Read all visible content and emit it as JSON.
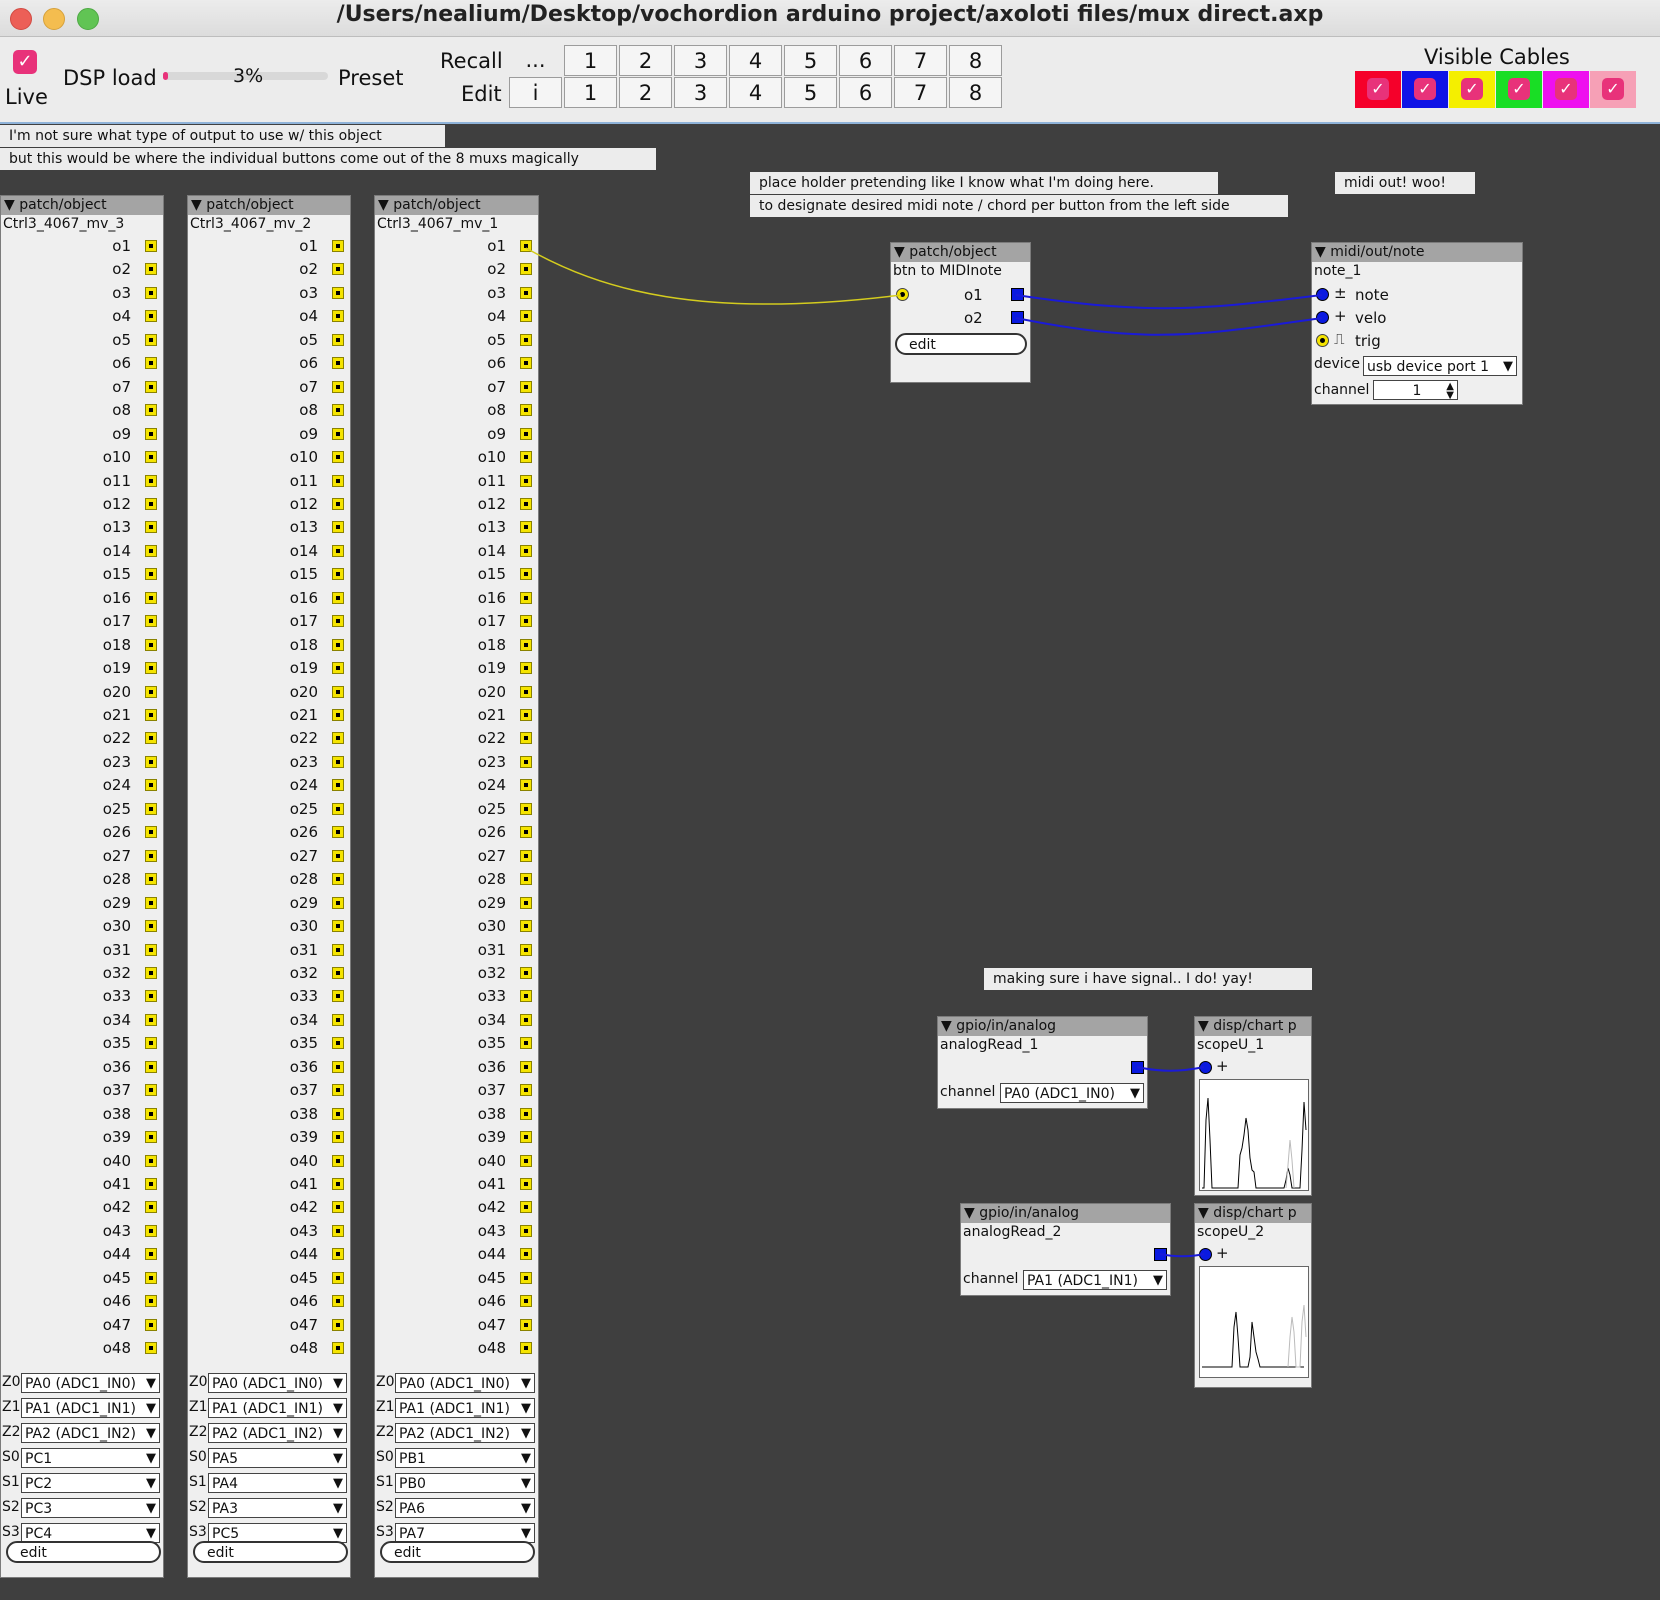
{
  "window": {
    "title": "/Users/nealium/Desktop/vochordion arduino  project/axoloti files/mux direct.axp"
  },
  "toolbar": {
    "live_label": "Live",
    "dsp_label": "DSP load",
    "dsp_value": "3%",
    "dsp_fraction": 0.03,
    "preset_label": "Preset",
    "recall_label": "Recall",
    "recall_extra": "...",
    "edit_label": "Edit",
    "edit_extra": "i",
    "preset_numbers": [
      "1",
      "2",
      "3",
      "4",
      "5",
      "6",
      "7",
      "8"
    ],
    "visible_cables_label": "Visible Cables",
    "cable_colors": [
      "#f5002a",
      "#0f13e6",
      "#f4ef00",
      "#19de25",
      "#ee10ef",
      "#f6a0b6"
    ]
  },
  "comments": {
    "c1": "I'm not sure what type of output to use w/ this object",
    "c2": "but this would be where the individual buttons come out of the 8 muxs magically",
    "c3": "place holder pretending like I know what I'm doing here.",
    "c4": "to designate desired midi note / chord per button from the left side",
    "c5": "midi out! woo!",
    "c6": "making sure i have signal.. I do! yay!"
  },
  "mux_objects": [
    {
      "type": "patch/object",
      "name": "Ctrl3_4067_mv_3",
      "params": [
        {
          "label": "Z0",
          "value": "PA0 (ADC1_IN0)"
        },
        {
          "label": "Z1",
          "value": "PA1 (ADC1_IN1)"
        },
        {
          "label": "Z2",
          "value": "PA2 (ADC1_IN2)"
        },
        {
          "label": "S0",
          "value": "PC1"
        },
        {
          "label": "S1",
          "value": "PC2"
        },
        {
          "label": "S2",
          "value": "PC3"
        },
        {
          "label": "S3",
          "value": "PC4"
        }
      ],
      "edit_label": "edit"
    },
    {
      "type": "patch/object",
      "name": "Ctrl3_4067_mv_2",
      "params": [
        {
          "label": "Z0",
          "value": "PA0 (ADC1_IN0)"
        },
        {
          "label": "Z1",
          "value": "PA1 (ADC1_IN1)"
        },
        {
          "label": "Z2",
          "value": "PA2 (ADC1_IN2)"
        },
        {
          "label": "S0",
          "value": "PA5"
        },
        {
          "label": "S1",
          "value": "PA4"
        },
        {
          "label": "S2",
          "value": "PA3"
        },
        {
          "label": "S3",
          "value": "PC5"
        }
      ],
      "edit_label": "edit"
    },
    {
      "type": "patch/object",
      "name": "Ctrl3_4067_mv_1",
      "params": [
        {
          "label": "Z0",
          "value": "PA0 (ADC1_IN0)"
        },
        {
          "label": "Z1",
          "value": "PA1 (ADC1_IN1)"
        },
        {
          "label": "Z2",
          "value": "PA2 (ADC1_IN2)"
        },
        {
          "label": "S0",
          "value": "PB1"
        },
        {
          "label": "S1",
          "value": "PB0"
        },
        {
          "label": "S2",
          "value": "PA6"
        },
        {
          "label": "S3",
          "value": "PA7"
        }
      ],
      "edit_label": "edit"
    }
  ],
  "outlets": [
    "o1",
    "o2",
    "o3",
    "o4",
    "o5",
    "o6",
    "o7",
    "o8",
    "o9",
    "o10",
    "o11",
    "o12",
    "o13",
    "o14",
    "o15",
    "o16",
    "o17",
    "o18",
    "o19",
    "o20",
    "o21",
    "o22",
    "o23",
    "o24",
    "o25",
    "o26",
    "o27",
    "o28",
    "o29",
    "o30",
    "o31",
    "o32",
    "o33",
    "o34",
    "o35",
    "o36",
    "o37",
    "o38",
    "o39",
    "o40",
    "o41",
    "o42",
    "o43",
    "o44",
    "o45",
    "o46",
    "o47",
    "o48"
  ],
  "midi_patch": {
    "type": "patch/object",
    "name": "btn to MIDInote",
    "outlet1": "o1",
    "outlet2": "o2",
    "edit_label": "edit"
  },
  "midi_out": {
    "type": "midi/out/note",
    "name": "note_1",
    "inlets": [
      {
        "sym": "±",
        "label": "note"
      },
      {
        "sym": "+",
        "label": "velo"
      },
      {
        "sym": "⎍",
        "label": "trig"
      }
    ],
    "device_label": "device",
    "device_value": "usb device port 1",
    "channel_label": "channel",
    "channel_value": "1"
  },
  "analog1": {
    "type": "gpio/in/analog",
    "name": "analogRead_1",
    "channel_label": "channel",
    "channel_value": "PA0 (ADC1_IN0)"
  },
  "analog2": {
    "type": "gpio/in/analog",
    "name": "analogRead_2",
    "channel_label": "channel",
    "channel_value": "PA1 (ADC1_IN1)"
  },
  "scope1": {
    "type": "disp/chart p",
    "name": "scopeU_1",
    "inlet_sym": "+"
  },
  "scope2": {
    "type": "disp/chart p",
    "name": "scopeU_2",
    "inlet_sym": "+"
  }
}
